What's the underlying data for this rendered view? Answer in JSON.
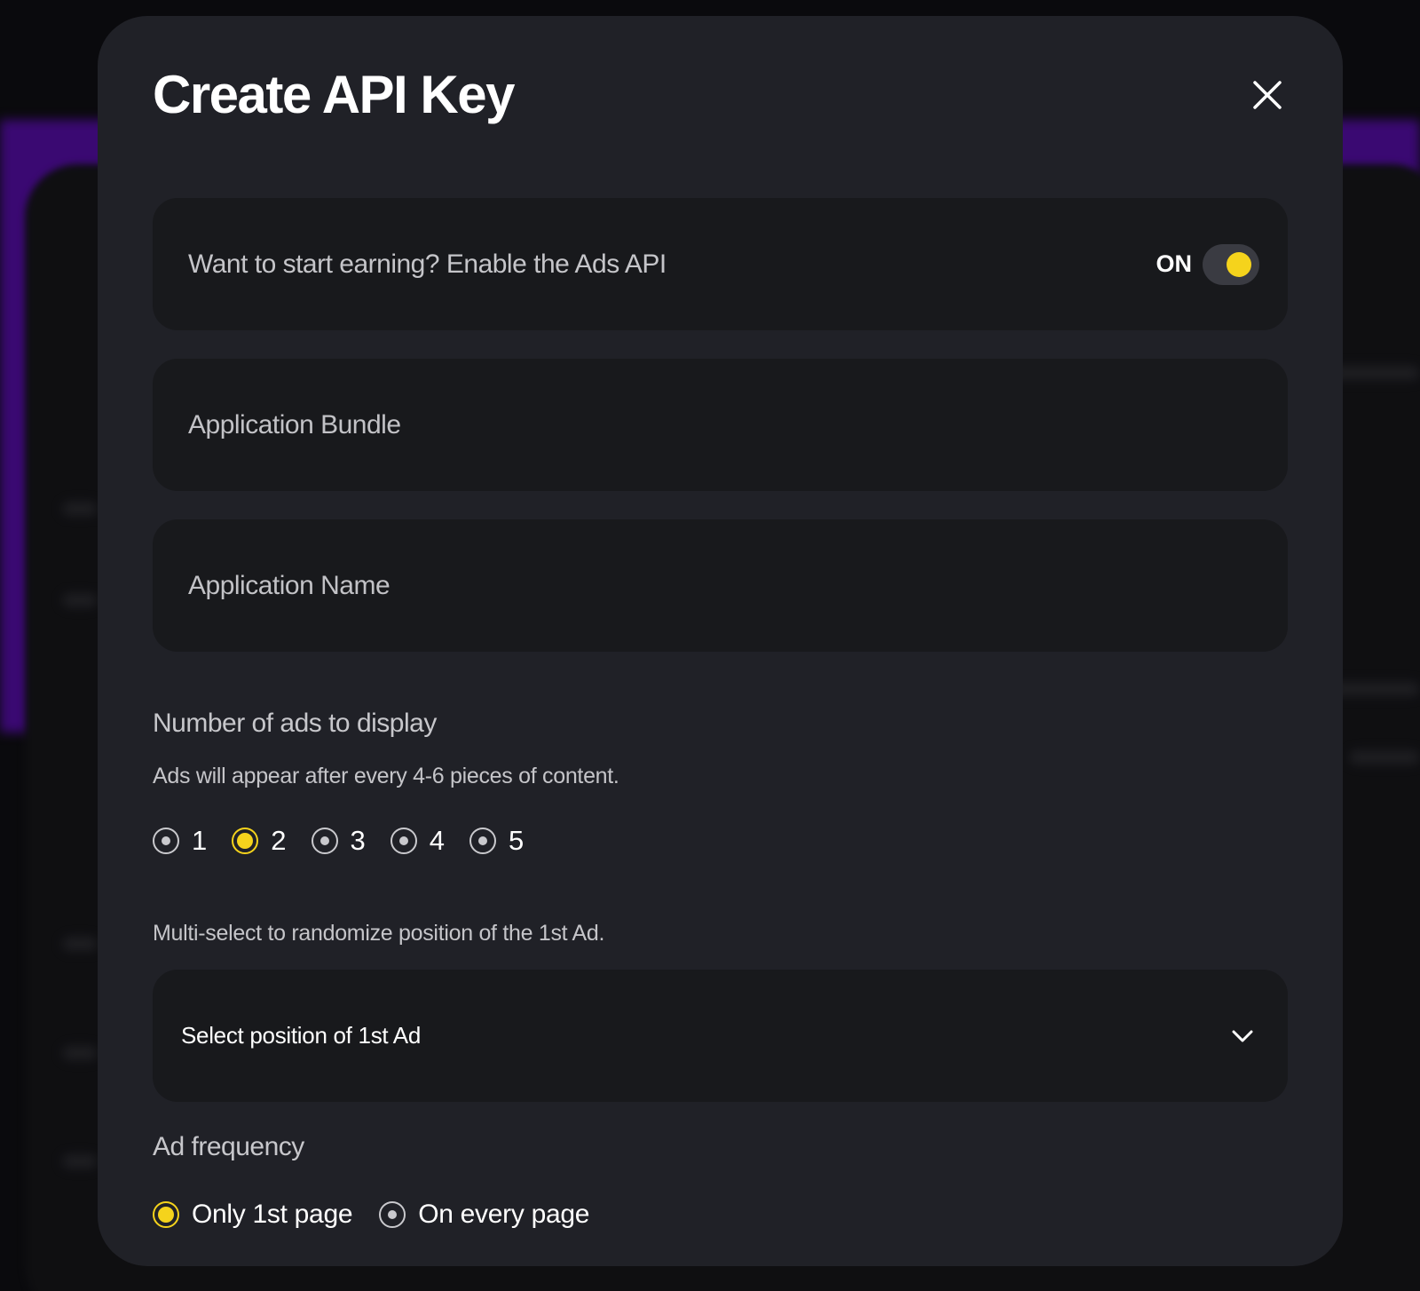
{
  "modal": {
    "title": "Create API Key"
  },
  "ads_toggle": {
    "label": "Want to start earning? Enable the Ads API",
    "state_label": "ON",
    "enabled": true
  },
  "fields": {
    "bundle_placeholder": "Application Bundle",
    "name_placeholder": "Application Name"
  },
  "ads_count": {
    "heading": "Number of ads to display",
    "description": "Ads will appear after every 4-6 pieces of content.",
    "options": [
      "1",
      "2",
      "3",
      "4",
      "5"
    ],
    "selected": "2"
  },
  "position": {
    "hint": "Multi-select to randomize position of the 1st Ad.",
    "placeholder": "Select position of 1st Ad"
  },
  "frequency": {
    "heading": "Ad frequency",
    "options": [
      "Only 1st page",
      "On every page"
    ],
    "selected": "Only 1st page"
  },
  "colors": {
    "accent": "#f5d31c",
    "modal_bg": "#202127",
    "panel_bg": "#18191c",
    "backdrop_purple": "#5a0eb0"
  },
  "icons": {
    "close": "close-icon",
    "chevron": "chevron-down-icon"
  }
}
